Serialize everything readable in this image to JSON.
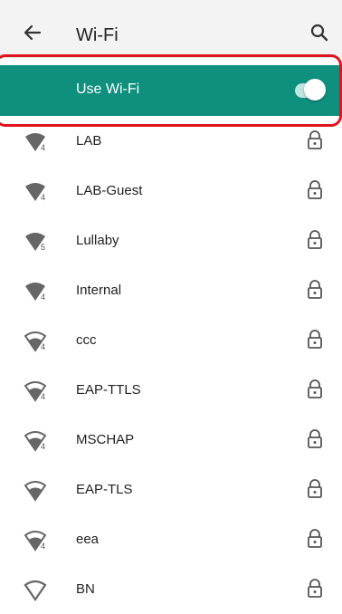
{
  "header": {
    "title": "Wi-Fi",
    "back_icon": "arrow-left-icon",
    "search_icon": "search-icon"
  },
  "toggle": {
    "label": "Use Wi-Fi",
    "state": "on",
    "accent": "#0f8f7d"
  },
  "networks": [
    {
      "name": "LAB",
      "signal": "full",
      "badge": "4",
      "secured": true
    },
    {
      "name": "LAB-Guest",
      "signal": "full",
      "badge": "4",
      "secured": true
    },
    {
      "name": "Lullaby",
      "signal": "full",
      "badge": "5",
      "secured": true
    },
    {
      "name": "Internal",
      "signal": "full",
      "badge": "4",
      "secured": true
    },
    {
      "name": "ccc",
      "signal": "partial",
      "badge": "4",
      "secured": true
    },
    {
      "name": "EAP-TTLS",
      "signal": "partial",
      "badge": "4",
      "secured": true
    },
    {
      "name": "MSCHAP",
      "signal": "partial",
      "badge": "4",
      "secured": true
    },
    {
      "name": "EAP-TLS",
      "signal": "partial",
      "badge": "",
      "secured": true
    },
    {
      "name": "eea",
      "signal": "partial",
      "badge": "4",
      "secured": true
    },
    {
      "name": "BN",
      "signal": "outline",
      "badge": "",
      "secured": true
    }
  ],
  "colors": {
    "highlight": "#e0141e",
    "row_text": "#222222"
  }
}
